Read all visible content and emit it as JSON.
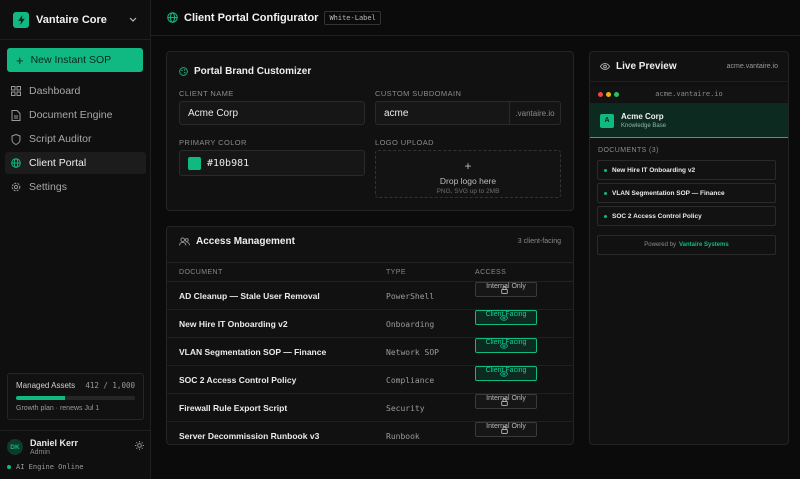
{
  "app": {
    "name": "Vantaire Core",
    "new_sop_label": "New Instant SOP"
  },
  "nav": [
    {
      "label": "Dashboard",
      "icon": "grid-icon"
    },
    {
      "label": "Document Engine",
      "icon": "file-icon"
    },
    {
      "label": "Script Auditor",
      "icon": "shield-icon"
    },
    {
      "label": "Client Portal",
      "icon": "globe-icon",
      "active": true
    },
    {
      "label": "Settings",
      "icon": "gear-icon"
    }
  ],
  "assets": {
    "title": "Managed Assets",
    "count": "412 / 1,000",
    "used_fraction": 0.412,
    "plan": "Growth plan · renews Jul 1"
  },
  "user": {
    "initials": "DK",
    "name": "Daniel Kerr",
    "role": "Admin",
    "status": "AI Engine Online"
  },
  "header": {
    "title": "Client Portal Configurator",
    "badge": "White-Label"
  },
  "brand_card": {
    "title": "Portal Brand Customizer",
    "client_name_label": "CLIENT NAME",
    "client_name_value": "Acme Corp",
    "subdomain_label": "CUSTOM SUBDOMAIN",
    "subdomain_value": "acme",
    "subdomain_suffix": ".vantaire.io",
    "color_label": "PRIMARY COLOR",
    "color_value": "#10b981",
    "logo_label": "LOGO UPLOAD",
    "logo_main": "Drop logo here",
    "logo_sub": "PNG, SVG up to 2MB"
  },
  "access": {
    "title": "Access Management",
    "count": "3 client-facing",
    "columns": [
      "DOCUMENT",
      "TYPE",
      "ACCESS"
    ],
    "rows": [
      {
        "document": "AD Cleanup — Stale User Removal",
        "type": "PowerShell",
        "access": "Internal Only"
      },
      {
        "document": "New Hire IT Onboarding v2",
        "type": "Onboarding",
        "access": "Client Facing"
      },
      {
        "document": "VLAN Segmentation SOP — Finance",
        "type": "Network SOP",
        "access": "Client Facing"
      },
      {
        "document": "SOC 2 Access Control Policy",
        "type": "Compliance",
        "access": "Client Facing"
      },
      {
        "document": "Firewall Rule Export Script",
        "type": "Security",
        "access": "Internal Only"
      },
      {
        "document": "Server Decommission Runbook v3",
        "type": "Runbook",
        "access": "Internal Only"
      }
    ]
  },
  "preview": {
    "title": "Live Preview",
    "domain": "acme.vantaire.io",
    "url": "acme.vantaire.io",
    "logo_letter": "A",
    "company": "Acme Corp",
    "subtitle": "Knowledge Base",
    "docs_label": "DOCUMENTS (3)",
    "docs": [
      "New Hire IT Onboarding v2",
      "VLAN Segmentation SOP — Finance",
      "SOC 2 Access Control Policy"
    ],
    "footer_prefix": "Powered by",
    "footer_brand": "Vantaire Systems"
  },
  "colors": {
    "accent": "#10b981",
    "background": "#0b0b0b"
  }
}
